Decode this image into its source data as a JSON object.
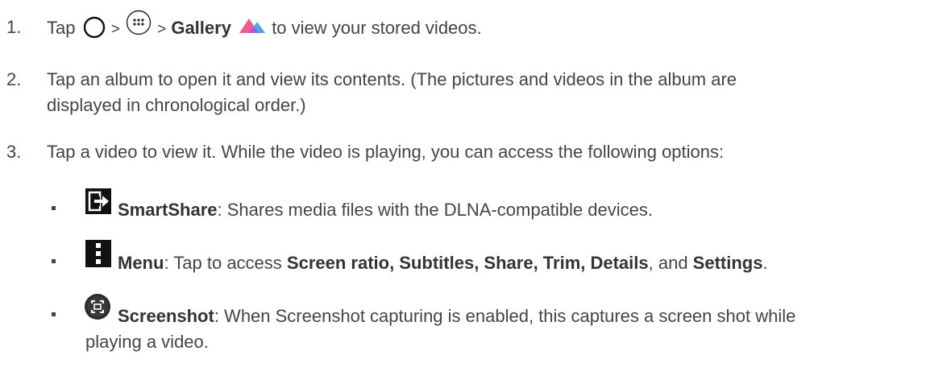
{
  "steps": [
    {
      "num": "1.",
      "tap": "Tap",
      "sep": ">",
      "gallery": "Gallery",
      "rest": "to view your stored videos."
    },
    {
      "num": "2.",
      "line1": "Tap an album to open it and view its contents. (The pictures and videos in the album are",
      "line2": "displayed in chronological order.)"
    },
    {
      "num": "3.",
      "text": "Tap a video to view it. While the video is playing, you can access the following options:"
    }
  ],
  "options": [
    {
      "icon": "smartshare-icon",
      "label": "SmartShare",
      "desc": ": Shares media files with the DLNA-compatible devices."
    },
    {
      "icon": "menu-icon",
      "label": "Menu",
      "desc_pre": ": Tap to access ",
      "items": "Screen ratio, Subtitles, Share, Trim, Details",
      "desc_mid": ", and ",
      "last": "Settings",
      "desc_end": "."
    },
    {
      "icon": "screenshot-icon",
      "label": "Screenshot",
      "desc1": ": When Screenshot capturing is enabled, this captures a screen shot while",
      "desc2": "playing a video."
    }
  ],
  "colors": {
    "text": "#444444",
    "gallery_icon_pink": "#f25a8c",
    "gallery_icon_blue": "#4aa8f0",
    "icon_dark": "#111111"
  }
}
